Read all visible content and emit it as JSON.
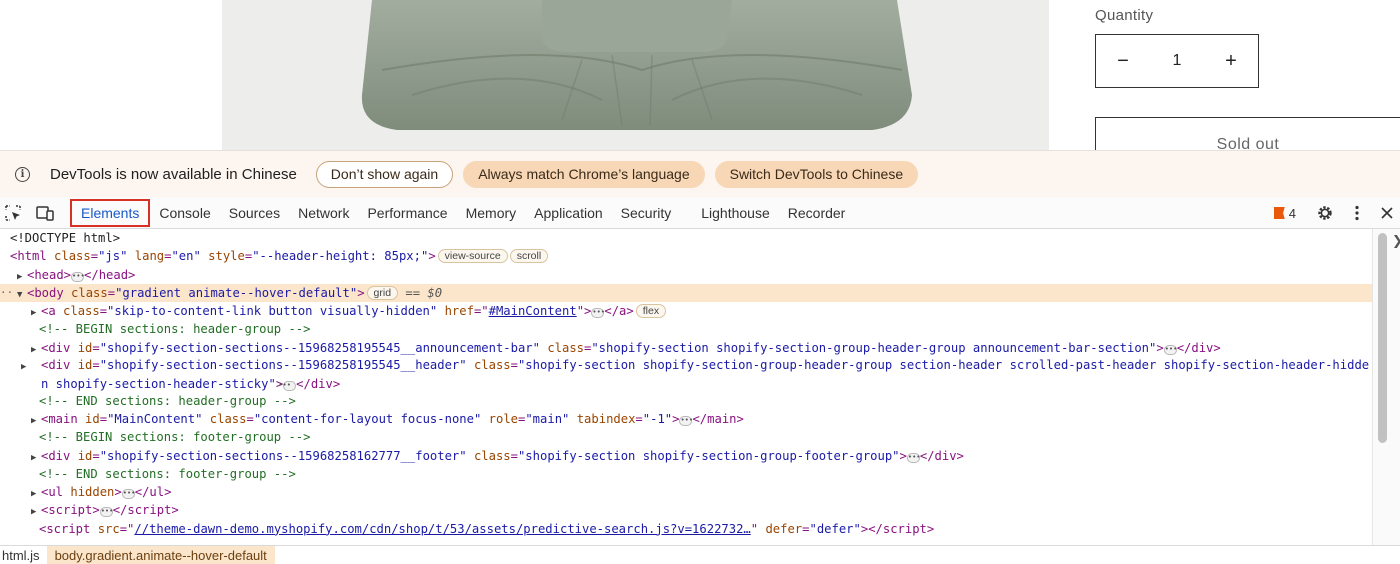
{
  "product": {
    "quantity_label": "Quantity",
    "quantity_value": "1",
    "decrement_label": "−",
    "increment_label": "+",
    "sold_out_label": "Sold out"
  },
  "infobar": {
    "icon": "info-icon",
    "message": "DevTools is now available in Chinese",
    "dont_show_label": "Don’t show again",
    "match_language_label": "Always match Chrome’s language",
    "switch_label": "Switch DevTools to Chinese"
  },
  "tabs": {
    "elements": "Elements",
    "console": "Console",
    "sources": "Sources",
    "network": "Network",
    "performance": "Performance",
    "memory": "Memory",
    "application": "Application",
    "security": "Security",
    "lighthouse": "Lighthouse",
    "recorder": "Recorder",
    "issues_count": "4"
  },
  "dom": {
    "doctype": "<!DOCTYPE html>",
    "html_class": "\"js\"",
    "html_lang": "\"en\"",
    "html_style": "\"--header-height: 85px;\"",
    "badge_view_source": "view-source",
    "badge_scroll": "scroll",
    "badge_grid": "grid",
    "badge_flex": "flex",
    "selected_marker": "== $0",
    "body_class": "\"gradient animate--hover-default\"",
    "a_class": "\"skip-to-content-link button visually-hidden\"",
    "a_href": "#MainContent",
    "comment_begin_header": "<!-- BEGIN sections: header-group -->",
    "div1_id": "\"shopify-section-sections--15968258195545__announcement-bar\"",
    "div1_class": "\"shopify-section shopify-section-group-header-group announcement-bar-section\"",
    "div2_id": "\"shopify-section-sections--15968258195545__header\"",
    "div2_class": "\"shopify-section shopify-section-group-header-group section-header scrolled-past-header shopify-section-header-hidden shopify-section-header-sticky\"",
    "comment_end_header": "<!-- END sections: header-group -->",
    "main_id": "\"MainContent\"",
    "main_class": "\"content-for-layout focus-none\"",
    "main_role": "\"main\"",
    "main_tabindex": "\"-1\"",
    "comment_begin_footer": "<!-- BEGIN sections: footer-group -->",
    "div3_id": "\"shopify-section-sections--15968258162777__footer\"",
    "div3_class": "\"shopify-section shopify-section-group-footer-group\"",
    "comment_end_footer": "<!-- END sections: footer-group -->",
    "ul_attr": "hidden",
    "script_src": "//theme-dawn-demo.myshopify.com/cdn/shop/t/53/assets/predictive-search.js?v=1622732…",
    "script_defer": "\"defer\""
  },
  "breadcrumb": {
    "file": "html.js",
    "current": "body.gradient.animate--hover-default"
  },
  "colors": {
    "selected_row": "#fbe6cc",
    "active_tab_outline": "#d93025",
    "pill_filled": "#f7d7b5",
    "infobar_bg": "#fdf5ef"
  }
}
